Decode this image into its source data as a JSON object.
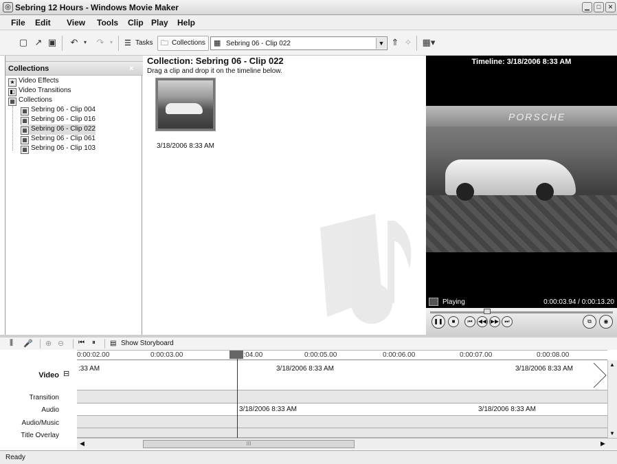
{
  "window": {
    "title": "Sebring 12 Hours - Windows Movie Maker"
  },
  "menu": [
    "File",
    "Edit",
    "View",
    "Tools",
    "Clip",
    "Play",
    "Help"
  ],
  "toolbar": {
    "tasks_label": "Tasks",
    "collections_label": "Collections",
    "collection_select_value": "Sebring 06 - Clip 022"
  },
  "collections_pane": {
    "header": "Collections",
    "close": "×",
    "items": [
      {
        "label": "Video Effects",
        "icon": "star-icon",
        "indent": 0
      },
      {
        "label": "Video Transitions",
        "icon": "transition-icon",
        "indent": 0
      },
      {
        "label": "Collections",
        "icon": "collections-icon",
        "indent": 0
      },
      {
        "label": "Sebring 06 - Clip 004",
        "icon": "collection-icon",
        "indent": 1
      },
      {
        "label": "Sebring 06 - Clip 016",
        "icon": "collection-icon",
        "indent": 1
      },
      {
        "label": "Sebring 06 - Clip 022",
        "icon": "collection-icon",
        "indent": 1,
        "selected": true
      },
      {
        "label": "Sebring 06 - Clip 061",
        "icon": "collection-icon",
        "indent": 1
      },
      {
        "label": "Sebring 06 - Clip 103",
        "icon": "collection-icon",
        "indent": 1
      }
    ]
  },
  "content": {
    "title": "Collection: Sebring 06 - Clip 022",
    "subtitle": "Drag a clip and drop it on the timeline below.",
    "clip_label": "3/18/2006 8:33 AM"
  },
  "preview": {
    "title": "Timeline: 3/18/2006 8:33 AM",
    "state": "Playing",
    "time": "0:00:03.94 / 0:00:13.20"
  },
  "timeline": {
    "toolbar": {
      "storyboard_label": "Show Storyboard"
    },
    "ruler": [
      "0:00:02.00",
      "0:00:03.00",
      "0:00:04.00",
      "0:00:05.00",
      "0:00:06.00",
      "0:00:07.00",
      "0:00:08.00"
    ],
    "tracks": {
      "video": "Video",
      "video_toggle": "⊟",
      "transition": "Transition",
      "audio": "Audio",
      "audio_music": "Audio/Music",
      "title_overlay": "Title Overlay"
    },
    "video_clips": [
      ":33 AM",
      "3/18/2006 8:33 AM",
      "3/18/2006 8:33 AM"
    ],
    "audio_clips": [
      "3/18/2006 8:33 AM",
      "3/18/2006 8:33 AM"
    ],
    "hscroll_mark": "III"
  },
  "status": "Ready"
}
